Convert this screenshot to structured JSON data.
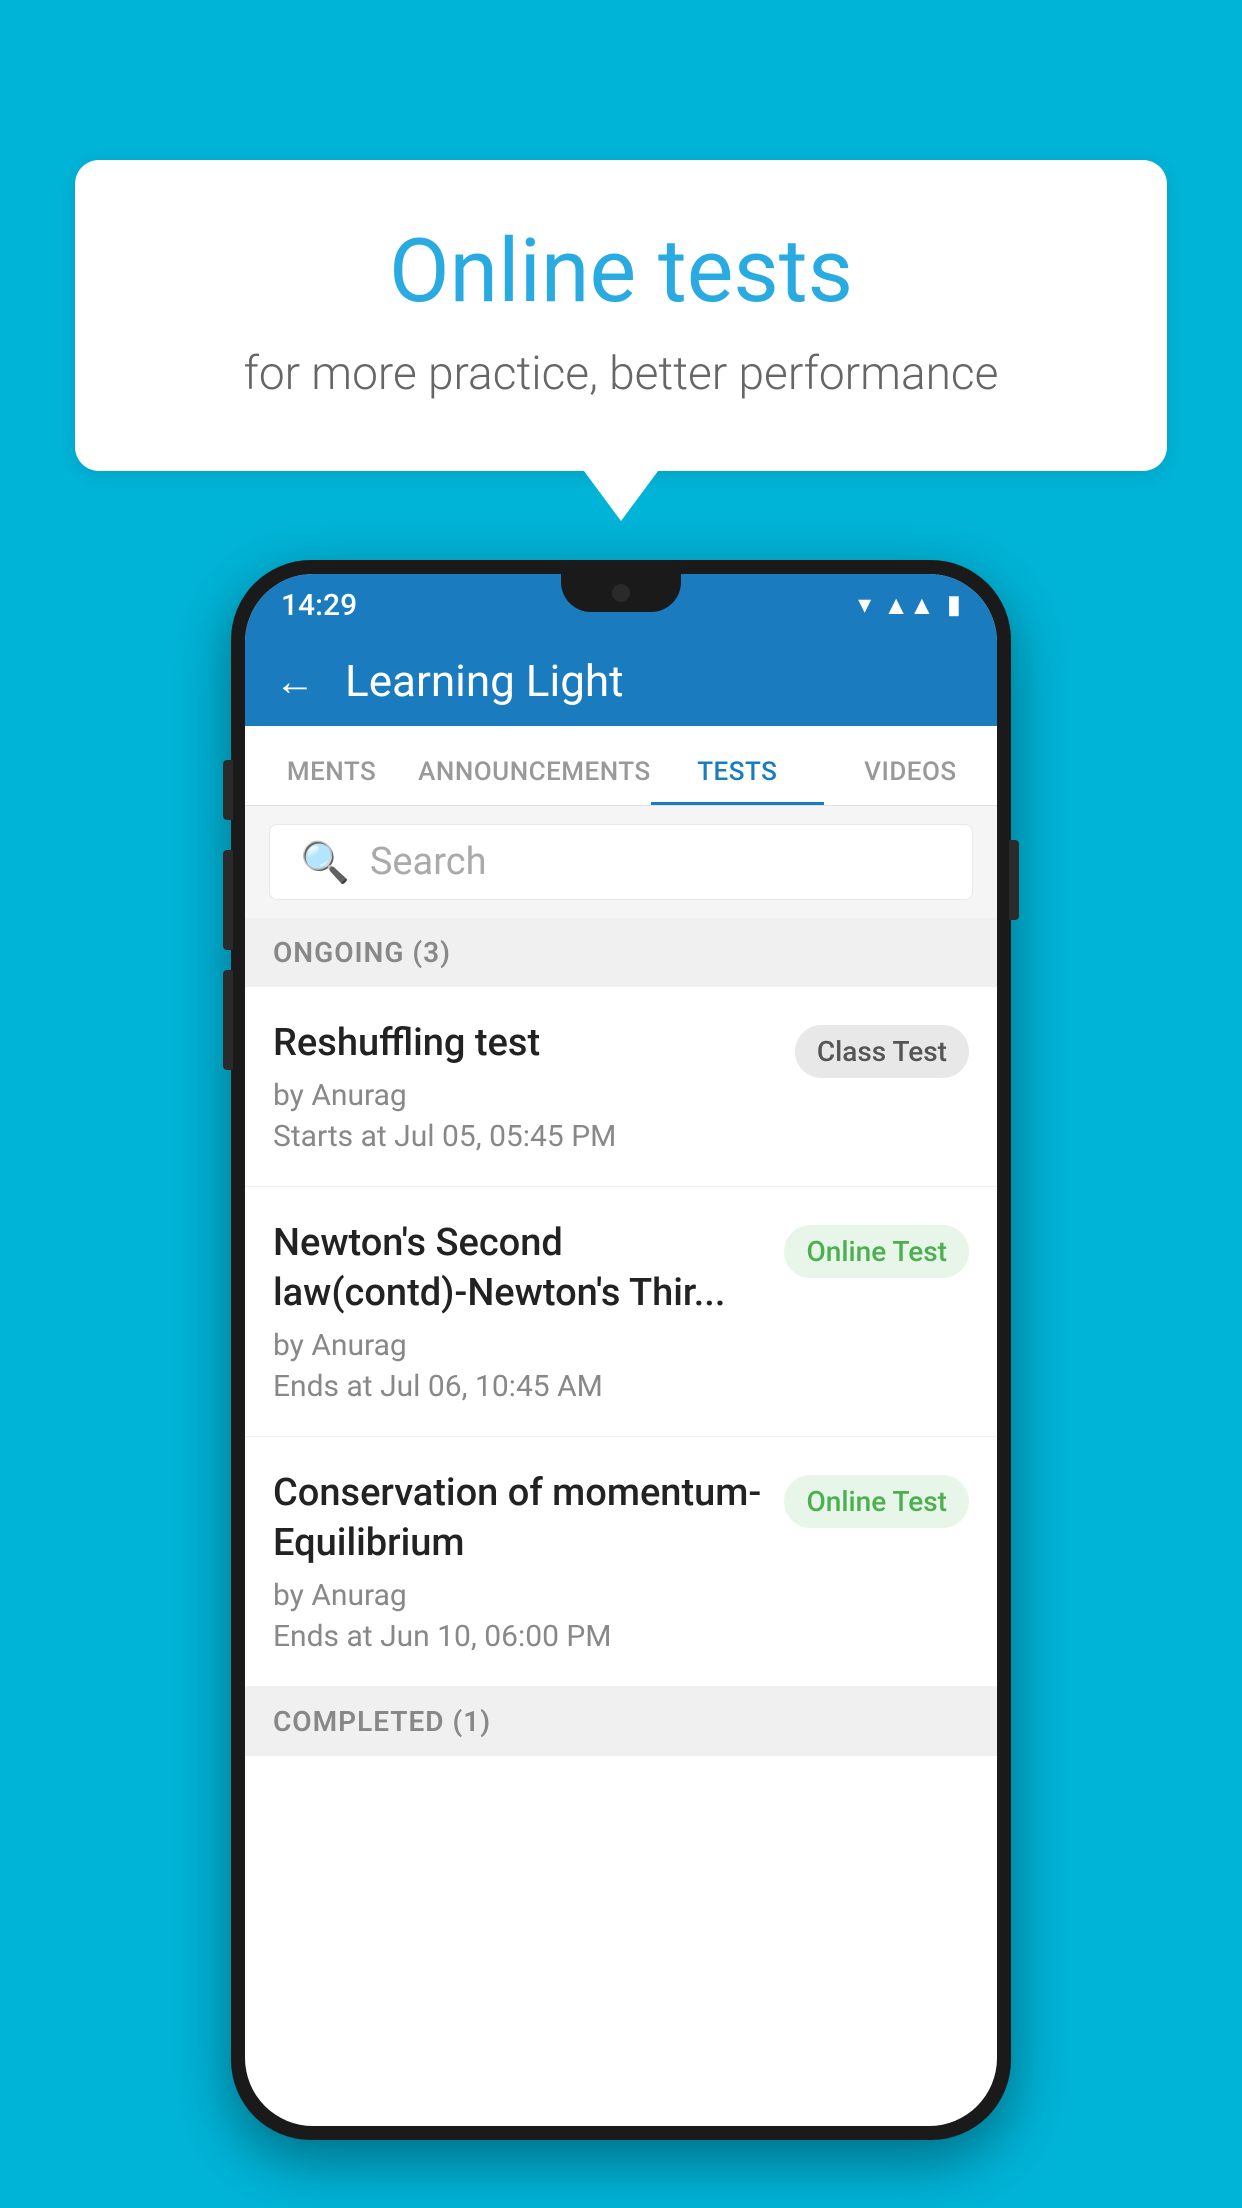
{
  "background": {
    "color": "#00b4d8"
  },
  "speech_bubble": {
    "title": "Online tests",
    "subtitle": "for more practice, better performance"
  },
  "phone": {
    "status_bar": {
      "time": "14:29",
      "icons": [
        "wifi",
        "signal",
        "battery"
      ]
    },
    "header": {
      "back_label": "←",
      "title": "Learning Light"
    },
    "tabs": [
      {
        "label": "MENTS",
        "active": false
      },
      {
        "label": "ANNOUNCEMENTS",
        "active": false
      },
      {
        "label": "TESTS",
        "active": true
      },
      {
        "label": "VIDEOS",
        "active": false
      }
    ],
    "search": {
      "placeholder": "Search"
    },
    "ongoing_section": {
      "label": "ONGOING (3)"
    },
    "test_items": [
      {
        "name": "Reshuffling test",
        "by": "by Anurag",
        "time_label": "Starts at",
        "time": "Jul 05, 05:45 PM",
        "badge": "Class Test",
        "badge_type": "class"
      },
      {
        "name": "Newton's Second law(contd)-Newton's Thir...",
        "by": "by Anurag",
        "time_label": "Ends at",
        "time": "Jul 06, 10:45 AM",
        "badge": "Online Test",
        "badge_type": "online"
      },
      {
        "name": "Conservation of momentum-Equilibrium",
        "by": "by Anurag",
        "time_label": "Ends at",
        "time": "Jun 10, 06:00 PM",
        "badge": "Online Test",
        "badge_type": "online"
      }
    ],
    "completed_section": {
      "label": "COMPLETED (1)"
    }
  }
}
